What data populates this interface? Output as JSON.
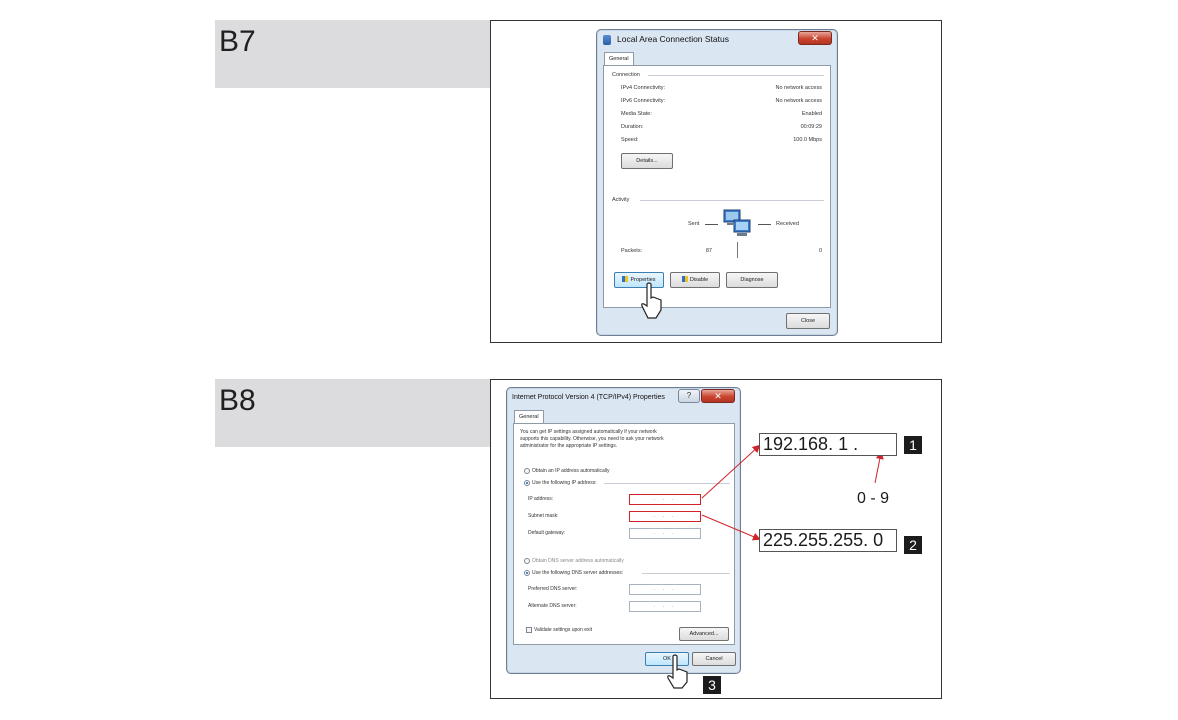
{
  "steps": {
    "b7": "B7",
    "b8": "B8"
  },
  "status_dialog": {
    "title": "Local Area Connection Status",
    "close_glyph": "✕",
    "tab": "General",
    "connection_label": "Connection",
    "rows": [
      {
        "label": "IPv4 Connectivity:",
        "value": "No network access"
      },
      {
        "label": "IPv6 Connectivity:",
        "value": "No network access"
      },
      {
        "label": "Media State:",
        "value": "Enabled"
      },
      {
        "label": "Duration:",
        "value": "00:09:29"
      },
      {
        "label": "Speed:",
        "value": "100.0 Mbps"
      }
    ],
    "details_button": "Details...",
    "activity_label": "Activity",
    "sent_label": "Sent",
    "received_label": "Received",
    "packets_label": "Packets:",
    "packets_sent": "87",
    "packets_received": "0",
    "properties_button": "Properties",
    "disable_button": "Disable",
    "diagnose_button": "Diagnose",
    "close_button": "Close"
  },
  "ipv4_dialog": {
    "title": "Internet Protocol Version 4 (TCP/IPv4) Properties",
    "help_glyph": "?",
    "close_glyph": "✕",
    "tab": "General",
    "intro_lines": [
      "You can get IP settings assigned automatically if your network",
      "supports this capability. Otherwise, you need to ask your network",
      "administrator for the appropriate IP settings."
    ],
    "obtain_ip_auto": "Obtain an IP address automatically",
    "use_following_ip": "Use the following IP address:",
    "ip_address_label": "IP address:",
    "subnet_mask_label": "Subnet mask:",
    "default_gateway_label": "Default gateway:",
    "obtain_dns_auto": "Obtain DNS server address automatically",
    "use_following_dns": "Use the following DNS server addresses:",
    "preferred_dns_label": "Preferred DNS server:",
    "alternate_dns_label": "Alternate DNS server:",
    "empty_ip": ". . .",
    "validate_label": "Validate settings upon exit",
    "advanced_button": "Advanced...",
    "ok_button": "OK",
    "cancel_button": "Cancel"
  },
  "callouts": {
    "ip_value": "192.168. 1  .",
    "ip_number": "1",
    "range_hint": "0 - 9",
    "mask_value": "225.255.255. 0",
    "mask_number": "2",
    "ok_number": "3"
  },
  "colors": {
    "highlight_red": "#d2232a",
    "step_band": "#dcdcde"
  }
}
